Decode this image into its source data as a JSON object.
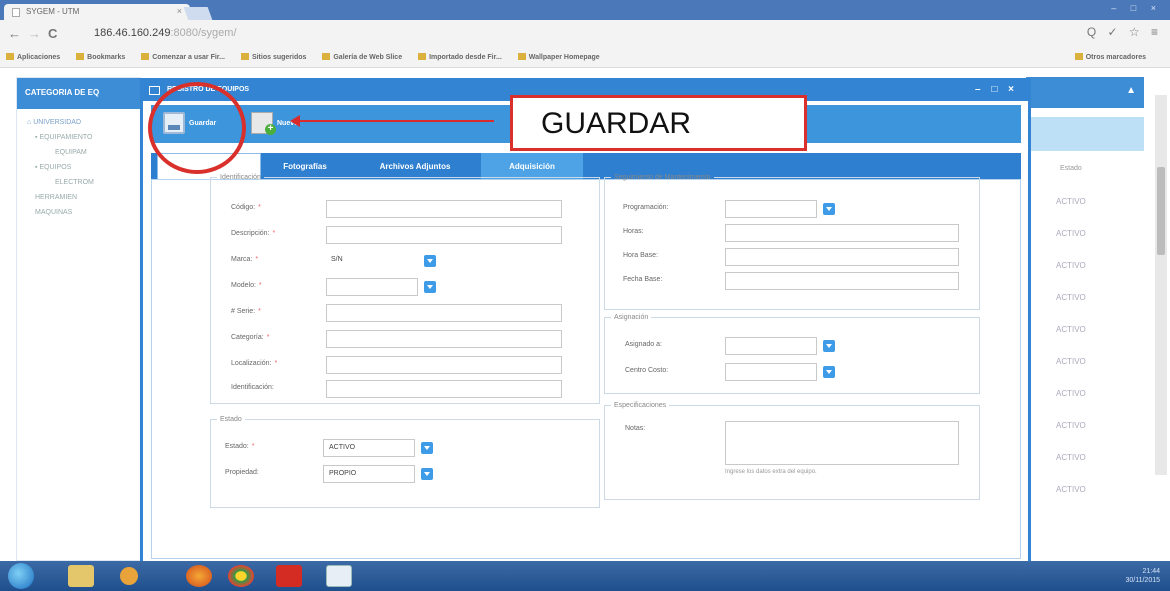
{
  "browser": {
    "tab_title": "SYGEM - UTM",
    "tab_close": "×",
    "window_controls": "– □ ×",
    "back_icon": "arrow-left",
    "reload_label": "C",
    "url_host": "186.46.160.249",
    "url_rest": ":8080/sygem/",
    "toolbar_icons": "Q ✓ ☆ ≡",
    "bookmarks": [
      "Aplicaciones",
      "Bookmarks",
      "Comenzar a usar Fir...",
      "Sitios sugeridos",
      "Galería de Web Slice",
      "Importado desde Fir...",
      "Wallpaper Homepage"
    ],
    "other_bookmarks": "Otros marcadores"
  },
  "background": {
    "left_panel_title": "CATEGORIA DE EQ",
    "tree": [
      {
        "label": "UNIVERSIDAD",
        "level": 0,
        "selected": true
      },
      {
        "label": "EQUIPAMIENTO",
        "level": 1
      },
      {
        "label": "EQUIPAM",
        "level": 2
      },
      {
        "label": "EQUIPOS",
        "level": 1
      },
      {
        "label": "ELECTROM",
        "level": 2
      },
      {
        "label": "HERRAMIEN",
        "level": 1
      },
      {
        "label": "MAQUINAS",
        "level": 1
      }
    ],
    "right_panel_header_icon": "▲",
    "right_panel_column": "Estado",
    "rows": [
      "ACTIVO",
      "ACTIVO",
      "ACTIVO",
      "ACTIVO",
      "ACTIVO",
      "ACTIVO",
      "ACTIVO",
      "ACTIVO",
      "ACTIVO",
      "ACTIVO"
    ]
  },
  "modal": {
    "title": "REGISTRO DE EQUIPOS",
    "controls": "– □ ×",
    "toolbar": {
      "save_label": "Guardar",
      "new_label": "Nuevo"
    },
    "tabs": [
      "Fotografías",
      "Archivos Adjuntos",
      "Adquisición"
    ],
    "identificacion": {
      "legend": "Identificación",
      "fields": [
        {
          "label": "Código:",
          "required": true,
          "value": ""
        },
        {
          "label": "Descripción:",
          "required": true,
          "value": ""
        },
        {
          "label": "Marca:",
          "required": true,
          "value": "S/N",
          "dropdown": true
        },
        {
          "label": "Modelo:",
          "required": true,
          "value": "",
          "dropdown": true
        },
        {
          "label": "# Serie:",
          "required": true,
          "value": ""
        },
        {
          "label": "Categoría:",
          "required": true,
          "value": ""
        },
        {
          "label": "Localización:",
          "required": true,
          "value": ""
        },
        {
          "label": "Identificación:",
          "required": false,
          "value": ""
        }
      ]
    },
    "estado": {
      "legend": "Estado",
      "fields": [
        {
          "label": "Estado:",
          "required": true,
          "value": "ACTIVO"
        },
        {
          "label": "Propiedad:",
          "required": false,
          "value": "PROPIO"
        }
      ]
    },
    "mantenimiento": {
      "legend": "Seguimiento de Mantenimiento",
      "fields": [
        {
          "label": "Programación:",
          "value": "",
          "dropdown": true
        },
        {
          "label": "Horas:",
          "value": ""
        },
        {
          "label": "Hora Base:",
          "value": ""
        },
        {
          "label": "Fecha Base:",
          "value": ""
        }
      ]
    },
    "asignacion": {
      "legend": "Asignación",
      "fields": [
        {
          "label": "Asignado a:",
          "value": ""
        },
        {
          "label": "Centro Costo:",
          "value": ""
        }
      ]
    },
    "especificaciones": {
      "legend": "Especificaciones",
      "notes_label": "Notas:",
      "notes_value": "",
      "notes_hint": "Ingrese los datos extra del equipo."
    }
  },
  "annotation": {
    "text": "GUARDAR",
    "color": "#d9302b"
  },
  "taskbar": {
    "time": "21:44",
    "date": "30/11/2015"
  }
}
